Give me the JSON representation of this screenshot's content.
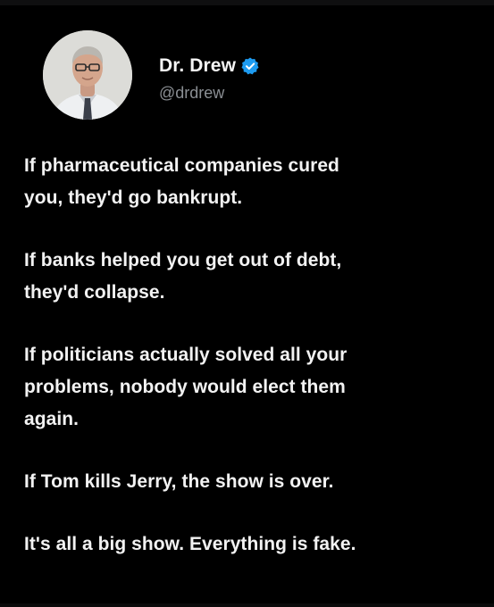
{
  "post": {
    "author": {
      "display_name": "Dr. Drew",
      "handle": "@drdrew",
      "verified_icon": "verified-badge-icon",
      "verified_color": "#1d9bf0"
    },
    "paragraphs": [
      {
        "lines": [
          "If pharmaceutical companies cured",
          "you, they'd go bankrupt."
        ]
      },
      {
        "lines": [
          "If banks helped you get out of debt,",
          "they'd collapse."
        ]
      },
      {
        "lines": [
          "If politicians actually solved all your",
          "problems, nobody would elect them",
          "again."
        ]
      },
      {
        "lines": [
          "If Tom kills Jerry, the show is over."
        ]
      },
      {
        "lines": [
          "It's all a big show. Everything is fake."
        ]
      }
    ]
  },
  "colors": {
    "background": "#000000",
    "text": "#f2f2f2",
    "handle": "#8b8f94"
  }
}
